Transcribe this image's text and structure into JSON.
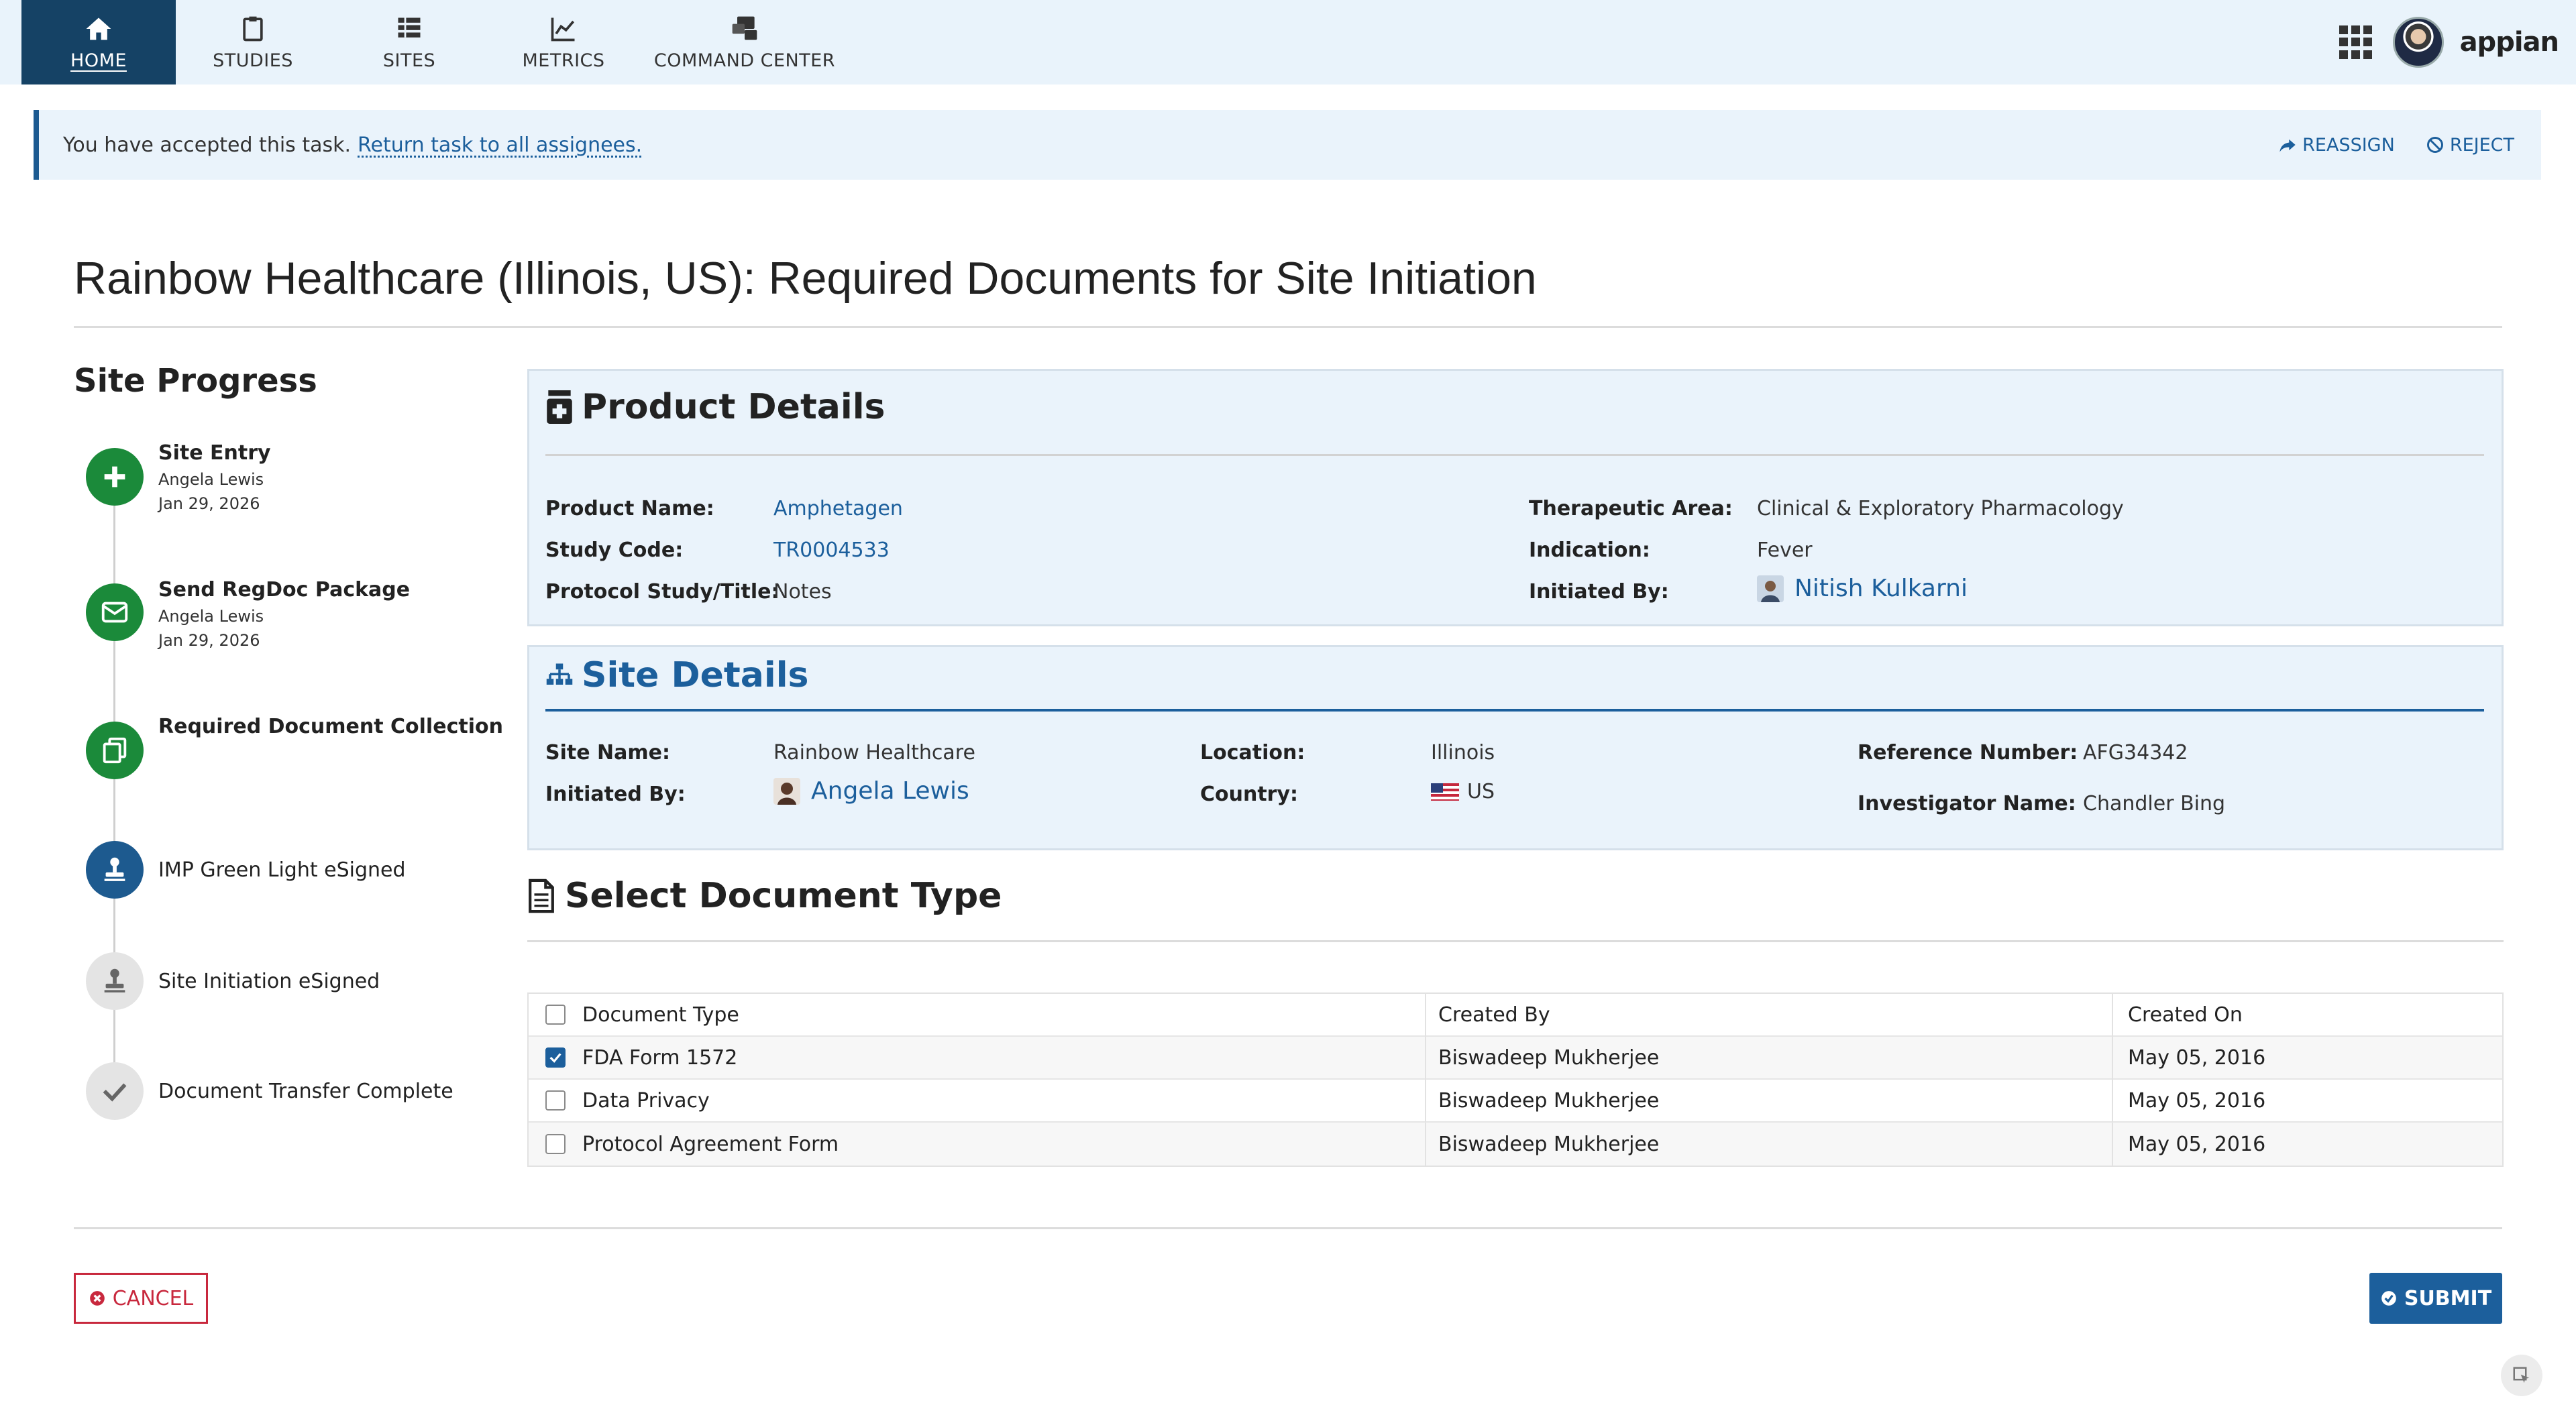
{
  "nav": {
    "items": [
      {
        "label": "HOME",
        "icon": "home-icon"
      },
      {
        "label": "STUDIES",
        "icon": "clipboard-icon"
      },
      {
        "label": "SITES",
        "icon": "list-icon"
      },
      {
        "label": "METRICS",
        "icon": "chart-icon"
      },
      {
        "label": "COMMAND CENTER",
        "icon": "command-center-icon"
      }
    ],
    "active": "HOME",
    "brand": "appian"
  },
  "banner": {
    "message": "You have accepted this task.",
    "link": "Return task to all assignees.",
    "reassign": "REASSIGN",
    "reject": "REJECT"
  },
  "page": {
    "title": "Rainbow Healthcare (Illinois, US): Required Documents for Site Initiation"
  },
  "progress": {
    "title": "Site Progress",
    "steps": [
      {
        "name": "Site Entry",
        "person": "Angela Lewis",
        "date": "Jan 29, 2026",
        "status": "complete"
      },
      {
        "name": "Send RegDoc Package",
        "person": "Angela Lewis",
        "date": "Jan 29, 2026",
        "status": "complete"
      },
      {
        "name": "Required Document Collection",
        "status": "current"
      },
      {
        "name": "IMP Green Light eSigned",
        "status": "next"
      },
      {
        "name": "Site Initiation eSigned",
        "status": "pending"
      },
      {
        "name": "Document Transfer Complete",
        "status": "pending"
      }
    ]
  },
  "product": {
    "title": "Product Details",
    "product_name_label": "Product Name:",
    "product_name": "Amphetagen",
    "study_code_label": "Study Code:",
    "study_code": "TR0004533",
    "protocol_label": "Protocol Study/Title:",
    "protocol": "Notes",
    "therapeutic_label": "Therapeutic Area:",
    "therapeutic": "Clinical & Exploratory Pharmacology",
    "indication_label": "Indication:",
    "indication": "Fever",
    "initiated_label": "Initiated By:",
    "initiated": "Nitish Kulkarni"
  },
  "site": {
    "title": "Site Details",
    "site_name_label": "Site Name:",
    "site_name": "Rainbow Healthcare",
    "initiated_label": "Initiated By:",
    "initiated": "Angela Lewis",
    "location_label": "Location:",
    "location": "Illinois",
    "country_label": "Country:",
    "country": "US",
    "reference_label": "Reference Number:",
    "reference": "AFG34342",
    "investigator_label": "Investigator Name:",
    "investigator": "Chandler Bing"
  },
  "documents": {
    "title": "Select Document Type",
    "columns": [
      "Document Type",
      "Created By",
      "Created On"
    ],
    "header_checked": false,
    "rows": [
      {
        "type": "FDA Form 1572",
        "created_by": "Biswadeep Mukherjee",
        "created_on": "May 05, 2016",
        "checked": true
      },
      {
        "type": "Data Privacy",
        "created_by": "Biswadeep Mukherjee",
        "created_on": "May 05, 2016",
        "checked": false
      },
      {
        "type": "Protocol Agreement Form",
        "created_by": "Biswadeep Mukherjee",
        "created_on": "May 05, 2016",
        "checked": false
      }
    ]
  },
  "footer": {
    "cancel": "CANCEL",
    "submit": "SUBMIT"
  },
  "colors": {
    "nav_bg": "#e9f3fb",
    "nav_active": "#154265",
    "link": "#1c5f9c",
    "step_green": "#1b8a3a",
    "step_blue": "#1d5a8f",
    "cancel_red": "#c8283d",
    "card_bg": "#eaf3fb"
  }
}
